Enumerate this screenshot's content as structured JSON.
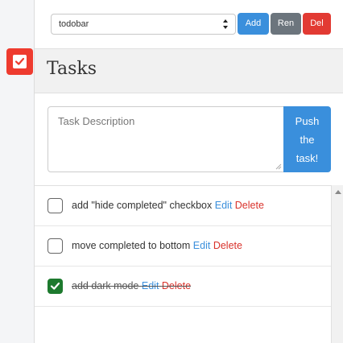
{
  "app": {
    "icon": "checkbox-icon",
    "accent": "#ee3b2f"
  },
  "toolbar": {
    "list_select_value": "todobar",
    "add_label": "Add",
    "rename_label": "Ren",
    "delete_label": "Del"
  },
  "header": {
    "title": "Tasks"
  },
  "task_input": {
    "placeholder": "Task Description",
    "push_label_line1": "Push",
    "push_label_line2": "the",
    "push_label_line3": "task!"
  },
  "tasks": [
    {
      "text": "add \"hide completed\" checkbox",
      "completed": false,
      "edit_label": "Edit",
      "delete_label": "Delete"
    },
    {
      "text": "move completed to bottom",
      "completed": false,
      "edit_label": "Edit",
      "delete_label": "Delete"
    },
    {
      "text": "add dark mode",
      "completed": true,
      "edit_label": "Edit",
      "delete_label": "Delete"
    }
  ],
  "colors": {
    "primary": "#3a8fdc",
    "secondary": "#6c757d",
    "danger": "#e23a33",
    "checked": "#1d7a2e"
  }
}
